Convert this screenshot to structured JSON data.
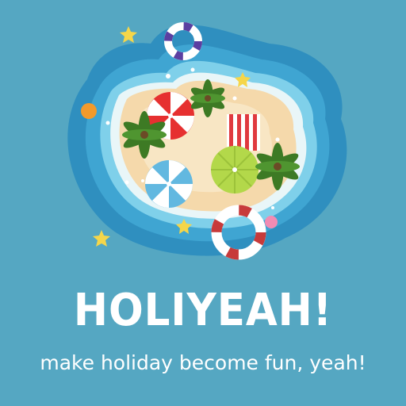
{
  "logo": {
    "title": "HOLIYEAH!",
    "tagline": "make holiday become fun, yeah!"
  },
  "colors": {
    "background": "#55a7c2",
    "water_dark": "#2f8fbf",
    "water_mid": "#3fa5d2",
    "water_light": "#7fd0ea",
    "foam": "#e9f6f8",
    "sand": "#f5d9ab",
    "sand_light": "#f8e6c4",
    "umbrella_red": "#e63030",
    "umbrella_green": "#b3d84a",
    "umbrella_blue": "#62b8e0",
    "palm": "#3d7a24",
    "ring_red": "#c73a3a",
    "ring_purple": "#5b3fa1",
    "star": "#f5d64a",
    "text": "#ffffff"
  },
  "icons": [
    "star-icon",
    "life-ring-icon",
    "beach-umbrella-icon",
    "palm-tree-icon",
    "beach-towel-icon",
    "orange-ball-icon"
  ]
}
